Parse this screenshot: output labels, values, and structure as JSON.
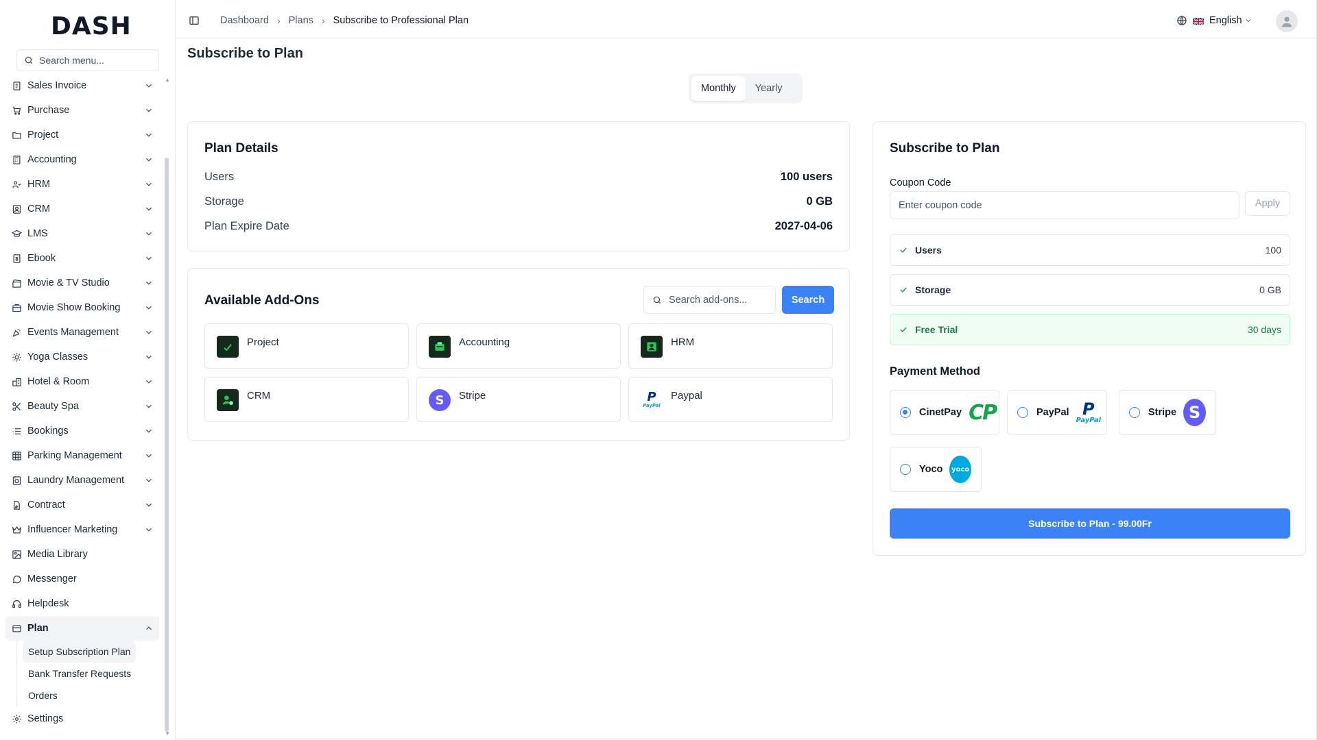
{
  "app": {
    "logo": "DASH"
  },
  "sidebar": {
    "search_placeholder": "Search menu...",
    "items": [
      {
        "label": "Sales Invoice",
        "icon": "invoice-icon",
        "expandable": true
      },
      {
        "label": "Purchase",
        "icon": "cart-icon",
        "expandable": true
      },
      {
        "label": "Project",
        "icon": "folder-icon",
        "expandable": true
      },
      {
        "label": "Accounting",
        "icon": "calculator-icon",
        "expandable": true
      },
      {
        "label": "HRM",
        "icon": "users-icon",
        "expandable": true
      },
      {
        "label": "CRM",
        "icon": "contact-icon",
        "expandable": true
      },
      {
        "label": "LMS",
        "icon": "graduation-cap-icon",
        "expandable": true
      },
      {
        "label": "Ebook",
        "icon": "book-icon",
        "expandable": true
      },
      {
        "label": "Movie & TV Studio",
        "icon": "clapperboard-icon",
        "expandable": true
      },
      {
        "label": "Movie Show Booking",
        "icon": "ticket-icon",
        "expandable": true
      },
      {
        "label": "Events Management",
        "icon": "party-icon",
        "expandable": true
      },
      {
        "label": "Yoga Classes",
        "icon": "sun-icon",
        "expandable": true
      },
      {
        "label": "Hotel & Room",
        "icon": "hotel-icon",
        "expandable": true
      },
      {
        "label": "Beauty Spa",
        "icon": "scissors-icon",
        "expandable": true
      },
      {
        "label": "Bookings",
        "icon": "list-icon",
        "expandable": true
      },
      {
        "label": "Parking Management",
        "icon": "grid-icon",
        "expandable": true
      },
      {
        "label": "Laundry Management",
        "icon": "washing-machine-icon",
        "expandable": true
      },
      {
        "label": "Contract",
        "icon": "file-signature-icon",
        "expandable": true
      },
      {
        "label": "Influencer Marketing",
        "icon": "crown-icon",
        "expandable": true
      },
      {
        "label": "Media Library",
        "icon": "image-icon",
        "expandable": false
      },
      {
        "label": "Messenger",
        "icon": "message-circle-icon",
        "expandable": false
      },
      {
        "label": "Helpdesk",
        "icon": "headphones-icon",
        "expandable": false
      },
      {
        "label": "Plan",
        "icon": "credit-card-icon",
        "expandable": true,
        "expanded": true,
        "active": true
      }
    ],
    "plan_subitems": [
      {
        "label": "Setup Subscription Plan",
        "active": true
      },
      {
        "label": "Bank Transfer Requests"
      },
      {
        "label": "Orders"
      }
    ],
    "settings_label": "Settings"
  },
  "topbar": {
    "breadcrumb": [
      "Dashboard",
      "Plans",
      "Subscribe to Professional Plan"
    ],
    "language": "English"
  },
  "page": {
    "title": "Subscribe to Plan",
    "billing_options": [
      "Monthly",
      "Yearly"
    ],
    "billing_selected": "Monthly"
  },
  "plan_details": {
    "title": "Plan Details",
    "rows": [
      {
        "label": "Users",
        "value": "100 users"
      },
      {
        "label": "Storage",
        "value": "0 GB"
      },
      {
        "label": "Plan Expire Date",
        "value": "2027-04-06"
      }
    ]
  },
  "addons": {
    "title": "Available Add-Ons",
    "search_placeholder": "Search add-ons...",
    "search_button": "Search",
    "items": [
      {
        "label": "Project",
        "icon": "project-addon-icon"
      },
      {
        "label": "Accounting",
        "icon": "accounting-addon-icon"
      },
      {
        "label": "HRM",
        "icon": "hrm-addon-icon"
      },
      {
        "label": "CRM",
        "icon": "crm-addon-icon"
      },
      {
        "label": "Stripe",
        "icon": "stripe-logo-icon"
      },
      {
        "label": "Paypal",
        "icon": "paypal-logo-icon"
      }
    ]
  },
  "subscribe": {
    "title": "Subscribe to Plan",
    "coupon_label": "Coupon Code",
    "coupon_placeholder": "Enter coupon code",
    "apply_button": "Apply",
    "features": [
      {
        "label": "Users",
        "value": "100"
      },
      {
        "label": "Storage",
        "value": "0 GB"
      },
      {
        "label": "Free Trial",
        "value": "30 days",
        "highlight": true
      }
    ],
    "payment_method_label": "Payment Method",
    "payment_methods": [
      {
        "label": "CinetPay",
        "selected": true
      },
      {
        "label": "PayPal",
        "selected": false
      },
      {
        "label": "Stripe",
        "selected": false
      },
      {
        "label": "Yoco",
        "selected": false
      }
    ],
    "payment_logo_texts": {
      "cinetpay": "CP",
      "paypal": "PayPal",
      "stripe": "S",
      "yoco": "yoco"
    },
    "subscribe_button": "Subscribe to Plan - 99.00Fr"
  },
  "colors": {
    "primary": "#3b82f6",
    "success": "#16a34a",
    "success_bg": "#f0fdf4",
    "cinetpay_green": "#16a34a",
    "stripe_purple": "#635bff",
    "yoco_blue": "#00a9e0"
  }
}
